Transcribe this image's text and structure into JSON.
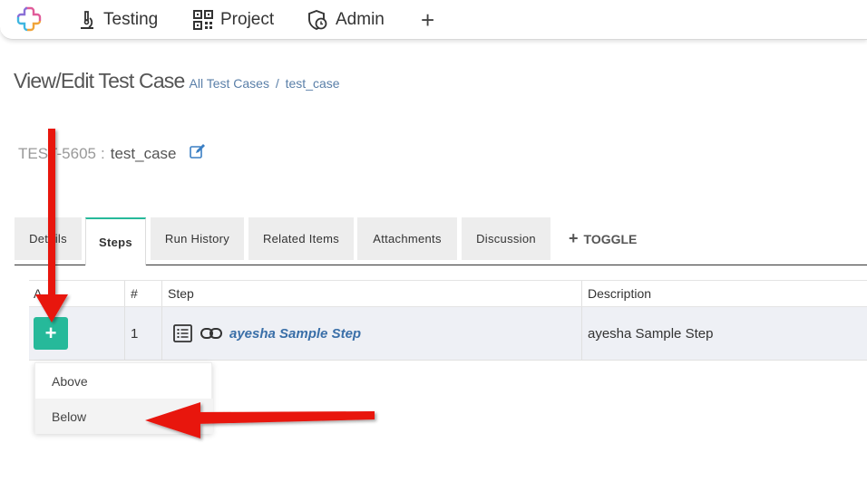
{
  "nav": {
    "testing": "Testing",
    "project": "Project",
    "admin": "Admin",
    "add": "+"
  },
  "header": {
    "title": "View/Edit Test Case",
    "breadcrumb": [
      "All Test Cases",
      "test_case"
    ],
    "separator": "/"
  },
  "test_case": {
    "code": "TEST-5605",
    "separator": ":",
    "name": "test_case"
  },
  "tabs": [
    {
      "label": "Details",
      "active": false
    },
    {
      "label": "Steps",
      "active": true
    },
    {
      "label": "Run History",
      "active": false
    },
    {
      "label": "Related Items",
      "active": false
    },
    {
      "label": "Attachments",
      "active": false
    },
    {
      "label": "Discussion",
      "active": false
    }
  ],
  "toggle": {
    "icon": "+",
    "label": "TOGGLE"
  },
  "grid": {
    "headers": {
      "actions": "A",
      "num": "#",
      "step": "Step",
      "description": "Description"
    },
    "rows": [
      {
        "num": "1",
        "step": "ayesha Sample Step",
        "description": "ayesha Sample Step",
        "add_icon": "+"
      }
    ]
  },
  "dropdown": {
    "items": [
      "Above",
      "Below"
    ],
    "hovered": "Below"
  },
  "colors": {
    "accent": "#26b99a",
    "link": "#3a6fa8",
    "annotation": "#e8120f"
  }
}
